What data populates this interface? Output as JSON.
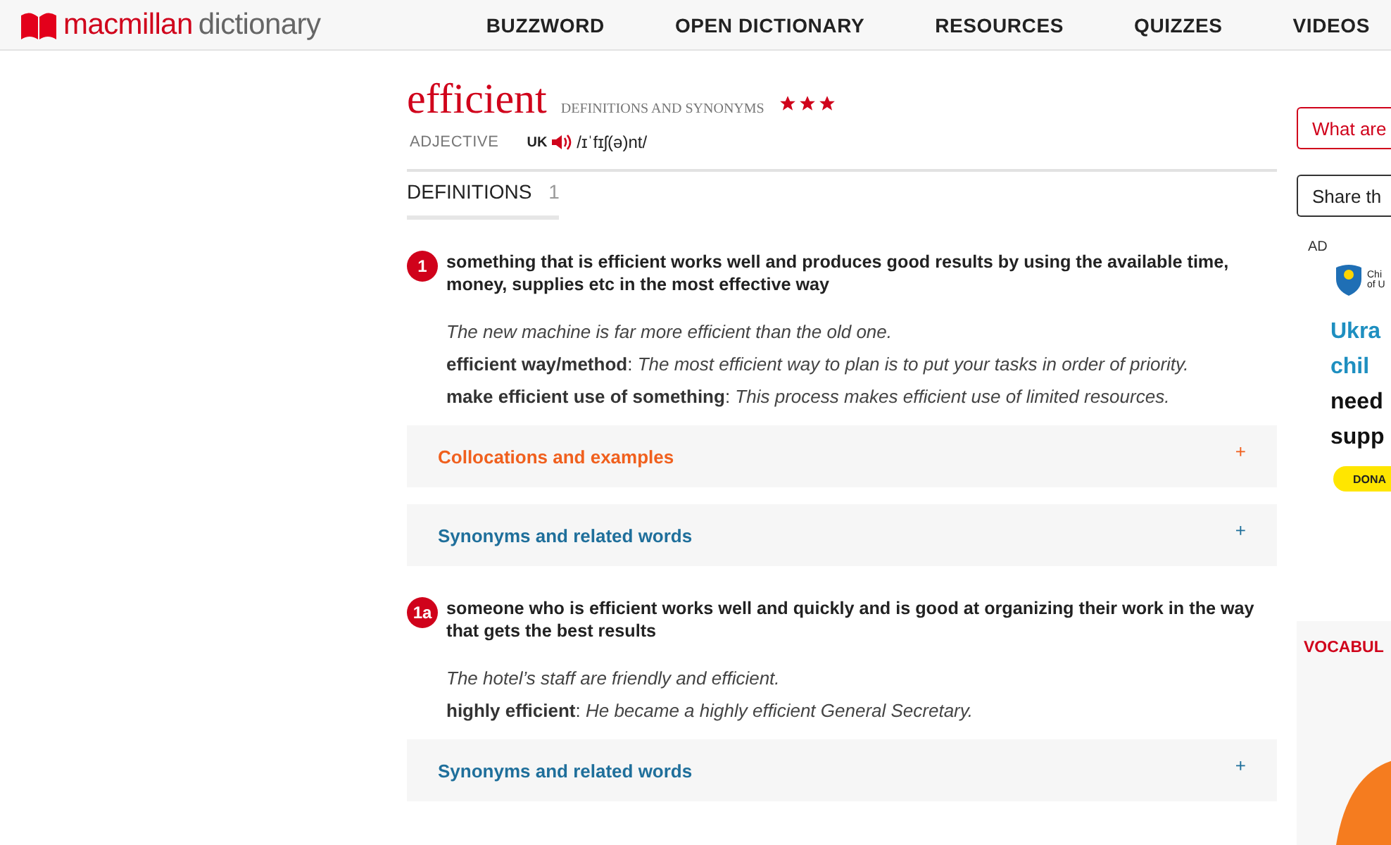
{
  "header": {
    "logo_text": "macmillan",
    "logo_text_2": "dictionary",
    "nav": [
      "BUZZWORD",
      "OPEN DICTIONARY",
      "RESOURCES",
      "QUIZZES",
      "VIDEOS"
    ]
  },
  "entry": {
    "headword": "efficient",
    "subtitle": "DEFINITIONS AND SYNONYMS",
    "stars": 3,
    "part_of_speech": "ADJECTIVE",
    "region": "UK",
    "pronunciation": "/ɪˈfɪʃ(ə)nt/"
  },
  "tabs": [
    {
      "label": "DEFINITIONS",
      "count": "1",
      "selected": true
    }
  ],
  "senses": [
    {
      "number": "1",
      "definition": "something that is efficient works well and produces good results by using the available time, money, supplies etc in the most effective way",
      "examples": [
        "*The new machine is far more efficient than the old one.*",
        "**efficient way/method**: *The most efficient way to plan is to put your tasks in order of priority.*",
        "**make efficient use of something**: *This process makes efficient use of limited resources.*"
      ],
      "panels": [
        {
          "kind": "collocations",
          "label": "Collocations and examples",
          "toggle": "+",
          "expanded": false
        },
        {
          "kind": "synonyms",
          "label": "Synonyms and related words",
          "toggle": "+",
          "expanded": false
        }
      ]
    },
    {
      "number": "1a",
      "definition": "someone who is efficient works well and quickly and is good at organizing their work in the way that gets the best results",
      "examples": [
        "*The hotel’s staff are friendly and efficient.*",
        "**highly efficient**: *He became a highly efficient General Secretary.*"
      ],
      "panels": [
        {
          "kind": "synonyms",
          "label": "Synonyms and related words",
          "toggle": "+",
          "expanded": false
        }
      ]
    }
  ],
  "sidebar": {
    "buttons": [
      {
        "kind": "accent",
        "label": "What are"
      },
      {
        "kind": "plain",
        "label": "Share th"
      }
    ],
    "ad": {
      "label": "AD",
      "logo_lines": [
        "Chi",
        "of U"
      ],
      "headline": [
        "Ukra",
        "chil"
      ],
      "body": [
        "need",
        "supp"
      ],
      "cta": "DONA"
    },
    "panel_title": "VOCABUL"
  }
}
